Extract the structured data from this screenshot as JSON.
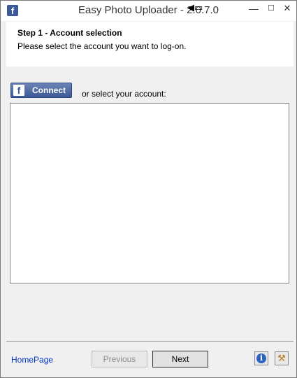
{
  "window": {
    "title": "Easy Photo Uploader - 2.0.7.0",
    "app_icon_glyph": "f",
    "title_glyphs": "◀▭",
    "controls": {
      "minimize": "—",
      "maximize": "☐",
      "close": "✕"
    }
  },
  "header": {
    "step_title": "Step 1 - Account selection",
    "description": "Please select the account you want to log-on."
  },
  "connect": {
    "icon_glyph": "f",
    "label": "Connect",
    "or_select_text": "or select your account:"
  },
  "account_list": {
    "items": []
  },
  "footer": {
    "homepage_label": "HomePage",
    "previous_label": "Previous",
    "next_label": "Next",
    "info_glyph": "i",
    "tools_glyph": "⚒"
  },
  "colors": {
    "facebook_blue": "#3b5998",
    "link_blue": "#0033cc",
    "info_blue": "#2a64c0"
  },
  "icons": [
    "facebook-icon",
    "facebook-f-icon",
    "info-icon",
    "tools-icon"
  ]
}
